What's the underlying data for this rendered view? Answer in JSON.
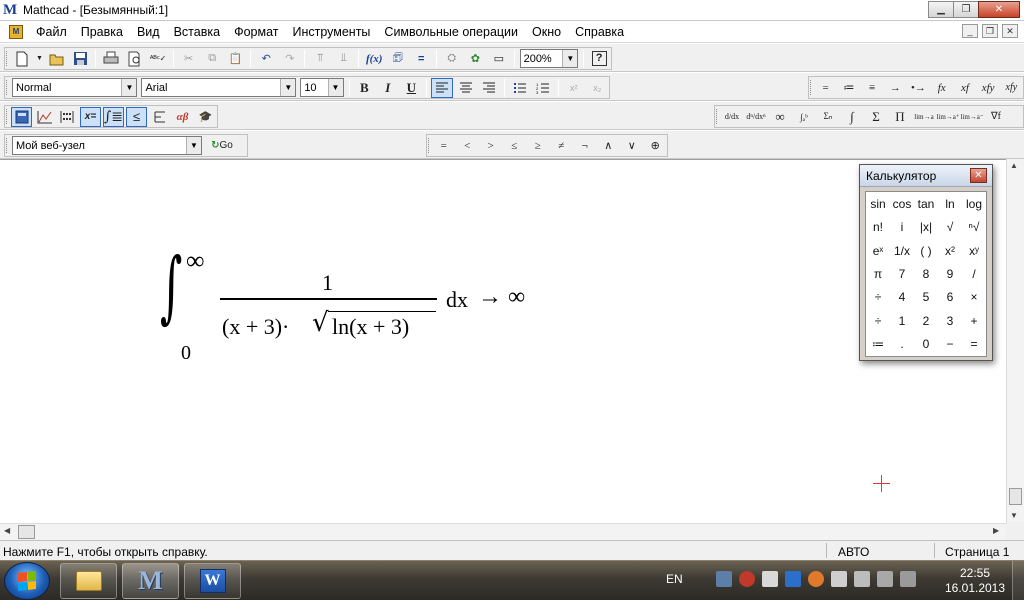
{
  "window": {
    "title": "Mathcad - [Безымянный:1]"
  },
  "menu": {
    "items": [
      "Файл",
      "Правка",
      "Вид",
      "Вставка",
      "Формат",
      "Инструменты",
      "Символьные операции",
      "Окно",
      "Справка"
    ]
  },
  "toolbar_standard": {
    "zoom": "200%"
  },
  "toolbar_format": {
    "style": "Normal",
    "font": "Arial",
    "size": "10",
    "bold": "B",
    "italic": "I",
    "underline": "U",
    "superscript": "x²",
    "subscript": "x₂"
  },
  "toolbar_symbolic": {
    "items": [
      "=",
      "≔",
      "≡",
      "→",
      "•→",
      "fx",
      "xf",
      "xfy",
      "xfy"
    ]
  },
  "toolbar_math_palette": {
    "xeq": "x=",
    "greek": "αβ"
  },
  "toolbar_calculus": {
    "items": [
      "d/dx",
      "dⁿ/dxⁿ",
      "∞",
      "∫ₐᵇ",
      "Σₙ",
      "∫",
      "Σ",
      "Π",
      "lim→a",
      "lim→a⁺",
      "lim→a⁻",
      "∇f"
    ]
  },
  "toolbar_web": {
    "location": "Мой веб-узел",
    "go": "Go"
  },
  "toolbar_boolean": {
    "items": [
      "=",
      "<",
      ">",
      "≤",
      "≥",
      "≠",
      "¬",
      "∧",
      "∨",
      "⊕"
    ]
  },
  "expression": {
    "upper_limit": "∞",
    "lower_limit": "0",
    "numerator": "1",
    "denominator_left": "(x + 3)·",
    "sqrt_content": "ln(x + 3)",
    "differential": "dx",
    "result": "→ ∞"
  },
  "calculator": {
    "title": "Калькулятор",
    "keys": [
      "sin",
      "cos",
      "tan",
      "ln",
      "log",
      "n!",
      "i",
      "|x|",
      "√",
      "ⁿ√",
      "eˣ",
      "1/x",
      "( )",
      "x²",
      "xʸ",
      "π",
      "7",
      "8",
      "9",
      "/",
      "÷",
      "4",
      "5",
      "6",
      "×",
      "÷",
      "1",
      "2",
      "3",
      "+",
      "≔",
      ".",
      "0",
      "−",
      "="
    ]
  },
  "status": {
    "help": "Нажмите F1, чтобы открыть справку.",
    "mode": "АВТО",
    "page": "Страница 1"
  },
  "taskbar": {
    "lang": "EN",
    "time": "22:55",
    "date": "16.01.2013"
  },
  "colors": {
    "cursor": "#e03a3a",
    "accent": "#3168c4"
  }
}
